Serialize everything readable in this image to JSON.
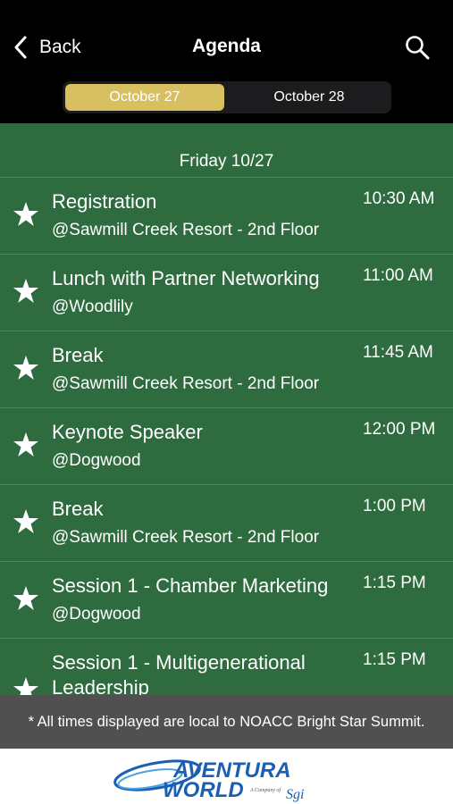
{
  "nav": {
    "back_label": "Back",
    "title": "Agenda"
  },
  "tabs": [
    {
      "label": "October 27",
      "selected": true
    },
    {
      "label": "October 28",
      "selected": false
    }
  ],
  "day_header": "Friday 10/27",
  "sessions": [
    {
      "name": "Registration",
      "location": "@Sawmill Creek Resort - 2nd Floor",
      "time": "10:30 AM"
    },
    {
      "name": "Lunch with Partner Networking",
      "location": "@Woodlily",
      "time": "11:00 AM"
    },
    {
      "name": "Break",
      "location": "@Sawmill Creek Resort - 2nd Floor",
      "time": "11:45 AM"
    },
    {
      "name": "Keynote Speaker",
      "location": "@Dogwood",
      "time": "12:00 PM"
    },
    {
      "name": "Break",
      "location": "@Sawmill Creek Resort - 2nd Floor",
      "time": "1:00 PM"
    },
    {
      "name": "Session 1 - Chamber Marketing",
      "location": "@Dogwood",
      "time": "1:15 PM"
    },
    {
      "name": "Session 1 - Multigenerational Leadership",
      "location": "",
      "time": "1:15 PM"
    }
  ],
  "footer_note": "* All times displayed are local to NOACC Bright Star Summit.",
  "brand": {
    "line1": "AVENTURA",
    "line2": "WORLD",
    "tagline": "A Company of",
    "parent": "Sgi"
  },
  "colors": {
    "background": "#000000",
    "list_bg": "#2e6b3e",
    "selected_tab": "#d8c060",
    "footer_bg": "#505050",
    "brand_blue": "#1a5fb4"
  },
  "icons": {
    "back": "chevron-left-icon",
    "search": "search-icon",
    "favorite": "star-icon"
  }
}
